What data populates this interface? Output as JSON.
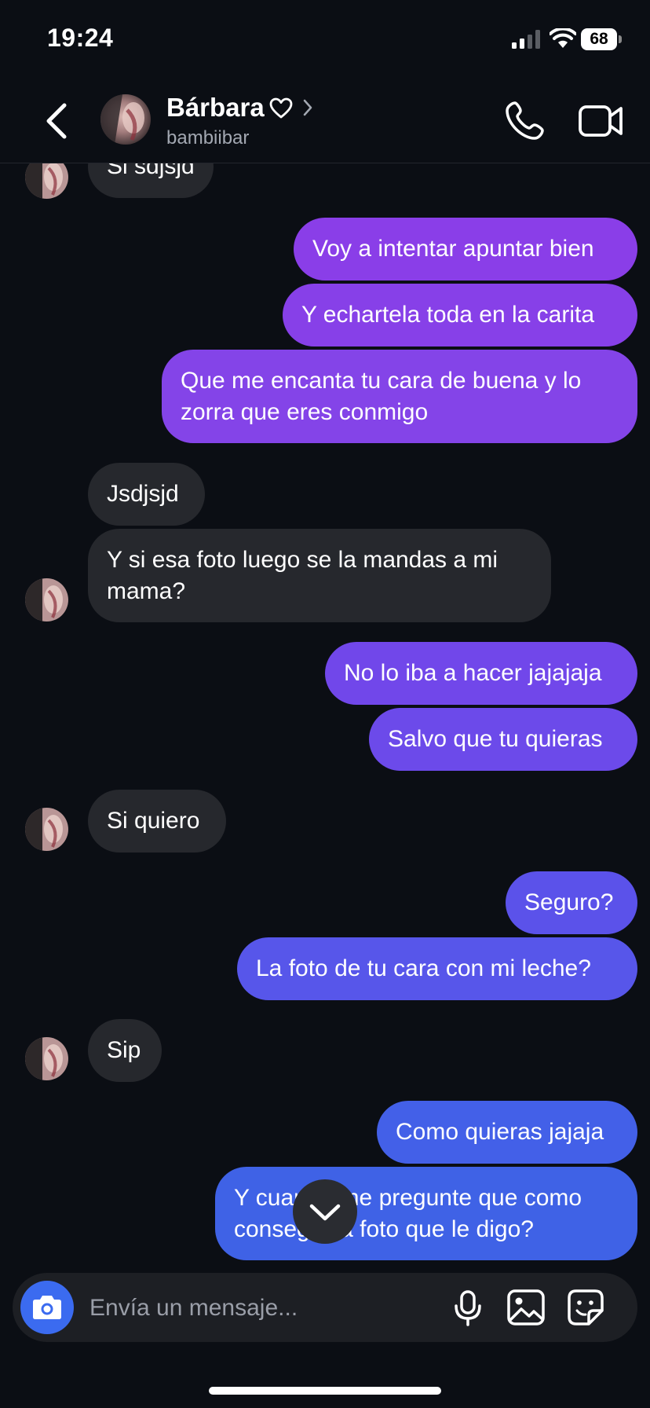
{
  "status_bar": {
    "time": "19:24",
    "battery": "68"
  },
  "header": {
    "name": "Bárbara",
    "username": "bambiibar",
    "icons": [
      "back-arrow",
      "heart",
      "chevron-right",
      "phone",
      "video-camera"
    ]
  },
  "messages": [
    {
      "side": "in",
      "text": "Si sdjsjd"
    },
    {
      "side": "out",
      "text": "Voy a intentar apuntar bien"
    },
    {
      "side": "out",
      "text": "Y echartela toda en la carita"
    },
    {
      "side": "out",
      "text": "Que me encanta tu cara de buena y lo zorra que eres conmigo"
    },
    {
      "side": "in",
      "text": "Jsdjsjd"
    },
    {
      "side": "in",
      "text": "Y si esa foto luego se la mandas a mi mama?"
    },
    {
      "side": "out",
      "text": "No lo iba a hacer jajajaja"
    },
    {
      "side": "out",
      "text": "Salvo que tu quieras"
    },
    {
      "side": "in",
      "text": "Si quiero"
    },
    {
      "side": "out",
      "text": "Seguro?"
    },
    {
      "side": "out",
      "text": "La foto de tu cara con mi leche?"
    },
    {
      "side": "in",
      "text": "Sip"
    },
    {
      "side": "out",
      "text": "Como quieras jajaja"
    },
    {
      "side": "out",
      "text": "Y cuando me pregunte que como consegui la foto que le digo?"
    }
  ],
  "composer": {
    "placeholder": "Envía un mensaje..."
  },
  "colors": {
    "background": "#0b0e14",
    "incoming_bubble": "#26282d",
    "outgoing_purple": "#8a3ee8",
    "outgoing_blue": "#3f5ee6",
    "camera_button": "#3b6bf0"
  }
}
